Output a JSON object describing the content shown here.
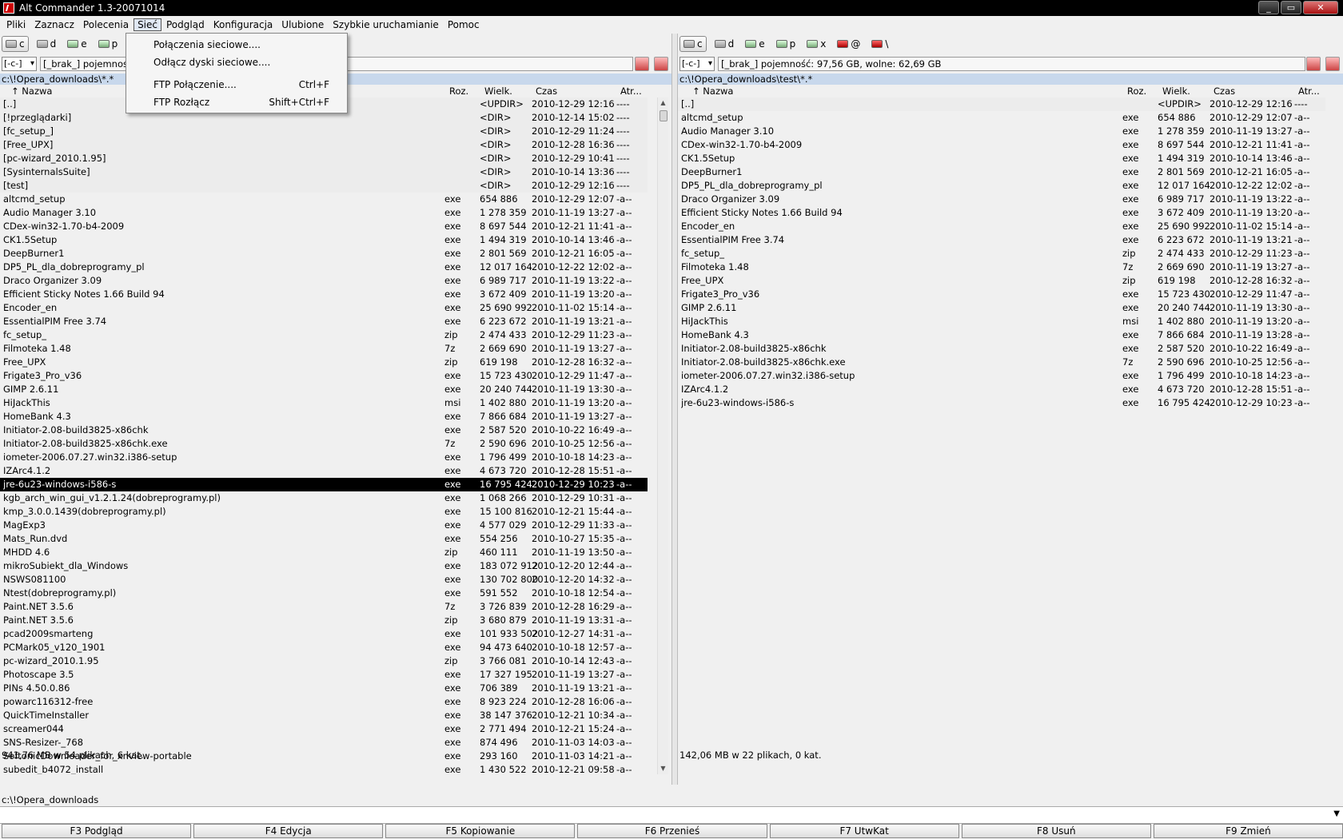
{
  "window": {
    "title": "Alt Commander 1.3-20071014",
    "buttons": [
      "_",
      "▭",
      "✕"
    ]
  },
  "menu": [
    "Pliki",
    "Zaznacz",
    "Polecenia",
    "Sieć",
    "Podgląd",
    "Konfiguracja",
    "Ulubione",
    "Szybkie uruchamianie",
    "Pomoc"
  ],
  "active_menu_index": 3,
  "dropdown": {
    "items": [
      {
        "label": "Połączenia sieciowe....",
        "shortcut": ""
      },
      {
        "label": "Odłącz dyski sieciowe....",
        "shortcut": ""
      },
      {
        "label": "FTP Połączenie....",
        "shortcut": "Ctrl+F"
      },
      {
        "label": "FTP Rozłącz",
        "shortcut": "Shift+Ctrl+F"
      }
    ]
  },
  "columns": {
    "name": "↑   Nazwa",
    "ext": "Roz.",
    "size": "Wielk.",
    "time": "Czas",
    "attr": "Atr..."
  },
  "left": {
    "drives": [
      {
        "letter": "c",
        "type": "disk"
      },
      {
        "letter": "d",
        "type": "cd"
      },
      {
        "letter": "e",
        "type": "net"
      },
      {
        "letter": "p",
        "type": "net"
      }
    ],
    "combo": "[-c-]",
    "volume": "[_brak_]  pojemność: 97,56 GB, wolne: 62,69 GB",
    "path": "c:\\!Opera_downloads\\*.*",
    "status": "941,76 MB w 54 plikach, 6 kat.",
    "files": [
      {
        "n": "[..]",
        "e": "",
        "s": "<UPDIR>",
        "t": "2010-12-29 12:16",
        "a": "----",
        "dir": true
      },
      {
        "n": "[!przeglądarki]",
        "e": "",
        "s": "<DIR>",
        "t": "2010-12-14 15:02",
        "a": "----",
        "dir": true
      },
      {
        "n": "[fc_setup_]",
        "e": "",
        "s": "<DIR>",
        "t": "2010-12-29 11:24",
        "a": "----",
        "dir": true
      },
      {
        "n": "[Free_UPX]",
        "e": "",
        "s": "<DIR>",
        "t": "2010-12-28 16:36",
        "a": "----",
        "dir": true
      },
      {
        "n": "[pc-wizard_2010.1.95]",
        "e": "",
        "s": "<DIR>",
        "t": "2010-12-29 10:41",
        "a": "----",
        "dir": true
      },
      {
        "n": "[SysinternalsSuite]",
        "e": "",
        "s": "<DIR>",
        "t": "2010-10-14 13:36",
        "a": "----",
        "dir": true
      },
      {
        "n": "[test]",
        "e": "",
        "s": "<DIR>",
        "t": "2010-12-29 12:16",
        "a": "----",
        "dir": true
      },
      {
        "n": "altcmd_setup",
        "e": "exe",
        "s": "654 886",
        "t": "2010-12-29 12:07",
        "a": "-a--"
      },
      {
        "n": "Audio Manager 3.10",
        "e": "exe",
        "s": "1 278 359",
        "t": "2010-11-19 13:27",
        "a": "-a--"
      },
      {
        "n": "CDex-win32-1.70-b4-2009",
        "e": "exe",
        "s": "8 697 544",
        "t": "2010-12-21 11:41",
        "a": "-a--"
      },
      {
        "n": "CK1.5Setup",
        "e": "exe",
        "s": "1 494 319",
        "t": "2010-10-14 13:46",
        "a": "-a--"
      },
      {
        "n": "DeepBurner1",
        "e": "exe",
        "s": "2 801 569",
        "t": "2010-12-21 16:05",
        "a": "-a--"
      },
      {
        "n": "DP5_PL_dla_dobreprogramy_pl",
        "e": "exe",
        "s": "12 017 164",
        "t": "2010-12-22 12:02",
        "a": "-a--"
      },
      {
        "n": "Draco Organizer 3.09",
        "e": "exe",
        "s": "6 989 717",
        "t": "2010-11-19 13:22",
        "a": "-a--"
      },
      {
        "n": "Efficient Sticky Notes 1.66 Build 94",
        "e": "exe",
        "s": "3 672 409",
        "t": "2010-11-19 13:20",
        "a": "-a--"
      },
      {
        "n": "Encoder_en",
        "e": "exe",
        "s": "25 690 992",
        "t": "2010-11-02 15:14",
        "a": "-a--"
      },
      {
        "n": "EssentialPIM Free 3.74",
        "e": "exe",
        "s": "6 223 672",
        "t": "2010-11-19 13:21",
        "a": "-a--"
      },
      {
        "n": "fc_setup_",
        "e": "zip",
        "s": "2 474 433",
        "t": "2010-12-29 11:23",
        "a": "-a--"
      },
      {
        "n": "Filmoteka 1.48",
        "e": "7z",
        "s": "2 669 690",
        "t": "2010-11-19 13:27",
        "a": "-a--"
      },
      {
        "n": "Free_UPX",
        "e": "zip",
        "s": "619 198",
        "t": "2010-12-28 16:32",
        "a": "-a--"
      },
      {
        "n": "Frigate3_Pro_v36",
        "e": "exe",
        "s": "15 723 430",
        "t": "2010-12-29 11:47",
        "a": "-a--"
      },
      {
        "n": "GIMP 2.6.11",
        "e": "exe",
        "s": "20 240 744",
        "t": "2010-11-19 13:30",
        "a": "-a--"
      },
      {
        "n": "HiJackThis",
        "e": "msi",
        "s": "1 402 880",
        "t": "2010-11-19 13:20",
        "a": "-a--"
      },
      {
        "n": "HomeBank 4.3",
        "e": "exe",
        "s": "7 866 684",
        "t": "2010-11-19 13:27",
        "a": "-a--"
      },
      {
        "n": "Initiator-2.08-build3825-x86chk",
        "e": "exe",
        "s": "2 587 520",
        "t": "2010-10-22 16:49",
        "a": "-a--"
      },
      {
        "n": "Initiator-2.08-build3825-x86chk.exe",
        "e": "7z",
        "s": "2 590 696",
        "t": "2010-10-25 12:56",
        "a": "-a--"
      },
      {
        "n": "iometer-2006.07.27.win32.i386-setup",
        "e": "exe",
        "s": "1 796 499",
        "t": "2010-10-18 14:23",
        "a": "-a--"
      },
      {
        "n": "IZArc4.1.2",
        "e": "exe",
        "s": "4 673 720",
        "t": "2010-12-28 15:51",
        "a": "-a--"
      },
      {
        "n": "jre-6u23-windows-i586-s",
        "e": "exe",
        "s": "16 795 424",
        "t": "2010-12-29 10:23",
        "a": "-a--",
        "sel": true
      },
      {
        "n": "kgb_arch_win_gui_v1.2.1.24(dobreprogramy.pl)",
        "e": "exe",
        "s": "1 068 266",
        "t": "2010-12-29 10:31",
        "a": "-a--"
      },
      {
        "n": "kmp_3.0.0.1439(dobreprogramy.pl)",
        "e": "exe",
        "s": "15 100 816",
        "t": "2010-12-21 15:44",
        "a": "-a--"
      },
      {
        "n": "MagExp3",
        "e": "exe",
        "s": "4 577 029",
        "t": "2010-12-29 11:33",
        "a": "-a--"
      },
      {
        "n": "Mats_Run.dvd",
        "e": "exe",
        "s": "554 256",
        "t": "2010-10-27 15:35",
        "a": "-a--"
      },
      {
        "n": "MHDD 4.6",
        "e": "zip",
        "s": "460 111",
        "t": "2010-11-19 13:50",
        "a": "-a--"
      },
      {
        "n": "mikroSubiekt_dla_Windows",
        "e": "exe",
        "s": "183 072 912",
        "t": "2010-12-20 12:44",
        "a": "-a--"
      },
      {
        "n": "NSWS081100",
        "e": "exe",
        "s": "130 702 800",
        "t": "2010-12-20 14:32",
        "a": "-a--"
      },
      {
        "n": "Ntest(dobreprogramy.pl)",
        "e": "exe",
        "s": "591 552",
        "t": "2010-10-18 12:54",
        "a": "-a--"
      },
      {
        "n": "Paint.NET 3.5.6",
        "e": "7z",
        "s": "3 726 839",
        "t": "2010-12-28 16:29",
        "a": "-a--"
      },
      {
        "n": "Paint.NET 3.5.6",
        "e": "zip",
        "s": "3 680 879",
        "t": "2010-11-19 13:31",
        "a": "-a--"
      },
      {
        "n": "pcad2009smarteng",
        "e": "exe",
        "s": "101 933 502",
        "t": "2010-12-27 14:31",
        "a": "-a--"
      },
      {
        "n": "PCMark05_v120_1901",
        "e": "exe",
        "s": "94 473 640",
        "t": "2010-10-18 12:57",
        "a": "-a--"
      },
      {
        "n": "pc-wizard_2010.1.95",
        "e": "zip",
        "s": "3 766 081",
        "t": "2010-10-14 12:43",
        "a": "-a--"
      },
      {
        "n": "Photoscape 3.5",
        "e": "exe",
        "s": "17 327 195",
        "t": "2010-11-19 13:27",
        "a": "-a--"
      },
      {
        "n": "PINs 4.50.0.86",
        "e": "exe",
        "s": "706 389",
        "t": "2010-11-19 13:21",
        "a": "-a--"
      },
      {
        "n": "powarc116312-free",
        "e": "exe",
        "s": "8 923 224",
        "t": "2010-12-28 16:06",
        "a": "-a--"
      },
      {
        "n": "QuickTimeInstaller",
        "e": "exe",
        "s": "38 147 376",
        "t": "2010-12-21 10:34",
        "a": "-a--"
      },
      {
        "n": "screamer044",
        "e": "exe",
        "s": "2 771 494",
        "t": "2010-12-21 15:24",
        "a": "-a--"
      },
      {
        "n": "SNS-Resizer-_768",
        "e": "exe",
        "s": "874 496",
        "t": "2010-11-03 14:03",
        "a": "-a--"
      },
      {
        "n": "SoftonicDownloader_for_xnview-portable",
        "e": "exe",
        "s": "293 160",
        "t": "2010-11-03 14:21",
        "a": "-a--"
      },
      {
        "n": "subedit_b4072_install",
        "e": "exe",
        "s": "1 430 522",
        "t": "2010-12-21 09:58",
        "a": "-a--"
      }
    ]
  },
  "right": {
    "drives": [
      {
        "letter": "c",
        "type": "disk"
      },
      {
        "letter": "d",
        "type": "cd"
      },
      {
        "letter": "e",
        "type": "net"
      },
      {
        "letter": "p",
        "type": "net"
      },
      {
        "letter": "x",
        "type": "net"
      },
      {
        "letter": "@",
        "type": "red"
      },
      {
        "letter": "\\",
        "type": "red"
      }
    ],
    "combo": "[-c-]",
    "volume": "[_brak_]  pojemność: 97,56 GB, wolne: 62,69 GB",
    "path": "c:\\!Opera_downloads\\test\\*.*",
    "status": "142,06 MB w 22 plikach, 0 kat.",
    "files": [
      {
        "n": "[..]",
        "e": "",
        "s": "<UPDIR>",
        "t": "2010-12-29 12:16",
        "a": "----",
        "dir": true
      },
      {
        "n": "altcmd_setup",
        "e": "exe",
        "s": "654 886",
        "t": "2010-12-29 12:07",
        "a": "-a--"
      },
      {
        "n": "Audio Manager 3.10",
        "e": "exe",
        "s": "1 278 359",
        "t": "2010-11-19 13:27",
        "a": "-a--"
      },
      {
        "n": "CDex-win32-1.70-b4-2009",
        "e": "exe",
        "s": "8 697 544",
        "t": "2010-12-21 11:41",
        "a": "-a--"
      },
      {
        "n": "CK1.5Setup",
        "e": "exe",
        "s": "1 494 319",
        "t": "2010-10-14 13:46",
        "a": "-a--"
      },
      {
        "n": "DeepBurner1",
        "e": "exe",
        "s": "2 801 569",
        "t": "2010-12-21 16:05",
        "a": "-a--"
      },
      {
        "n": "DP5_PL_dla_dobreprogramy_pl",
        "e": "exe",
        "s": "12 017 164",
        "t": "2010-12-22 12:02",
        "a": "-a--"
      },
      {
        "n": "Draco Organizer 3.09",
        "e": "exe",
        "s": "6 989 717",
        "t": "2010-11-19 13:22",
        "a": "-a--"
      },
      {
        "n": "Efficient Sticky Notes 1.66 Build 94",
        "e": "exe",
        "s": "3 672 409",
        "t": "2010-11-19 13:20",
        "a": "-a--"
      },
      {
        "n": "Encoder_en",
        "e": "exe",
        "s": "25 690 992",
        "t": "2010-11-02 15:14",
        "a": "-a--"
      },
      {
        "n": "EssentialPIM Free 3.74",
        "e": "exe",
        "s": "6 223 672",
        "t": "2010-11-19 13:21",
        "a": "-a--"
      },
      {
        "n": "fc_setup_",
        "e": "zip",
        "s": "2 474 433",
        "t": "2010-12-29 11:23",
        "a": "-a--"
      },
      {
        "n": "Filmoteka 1.48",
        "e": "7z",
        "s": "2 669 690",
        "t": "2010-11-19 13:27",
        "a": "-a--"
      },
      {
        "n": "Free_UPX",
        "e": "zip",
        "s": "619 198",
        "t": "2010-12-28 16:32",
        "a": "-a--"
      },
      {
        "n": "Frigate3_Pro_v36",
        "e": "exe",
        "s": "15 723 430",
        "t": "2010-12-29 11:47",
        "a": "-a--"
      },
      {
        "n": "GIMP 2.6.11",
        "e": "exe",
        "s": "20 240 744",
        "t": "2010-11-19 13:30",
        "a": "-a--"
      },
      {
        "n": "HiJackThis",
        "e": "msi",
        "s": "1 402 880",
        "t": "2010-11-19 13:20",
        "a": "-a--"
      },
      {
        "n": "HomeBank 4.3",
        "e": "exe",
        "s": "7 866 684",
        "t": "2010-11-19 13:28",
        "a": "-a--"
      },
      {
        "n": "Initiator-2.08-build3825-x86chk",
        "e": "exe",
        "s": "2 587 520",
        "t": "2010-10-22 16:49",
        "a": "-a--"
      },
      {
        "n": "Initiator-2.08-build3825-x86chk.exe",
        "e": "7z",
        "s": "2 590 696",
        "t": "2010-10-25 12:56",
        "a": "-a--"
      },
      {
        "n": "iometer-2006.07.27.win32.i386-setup",
        "e": "exe",
        "s": "1 796 499",
        "t": "2010-10-18 14:23",
        "a": "-a--"
      },
      {
        "n": "IZArc4.1.2",
        "e": "exe",
        "s": "4 673 720",
        "t": "2010-12-28 15:51",
        "a": "-a--"
      },
      {
        "n": "jre-6u23-windows-i586-s",
        "e": "exe",
        "s": "16 795 424",
        "t": "2010-12-29 10:23",
        "a": "-a--"
      }
    ]
  },
  "cmd_path": "c:\\!Opera_downloads",
  "fkeys": [
    "F3 Podgląd",
    "F4 Edycja",
    "F5 Kopiowanie",
    "F6 Przenieś",
    "F7 UtwKat",
    "F8 Usuń",
    "F9 Zmień"
  ]
}
